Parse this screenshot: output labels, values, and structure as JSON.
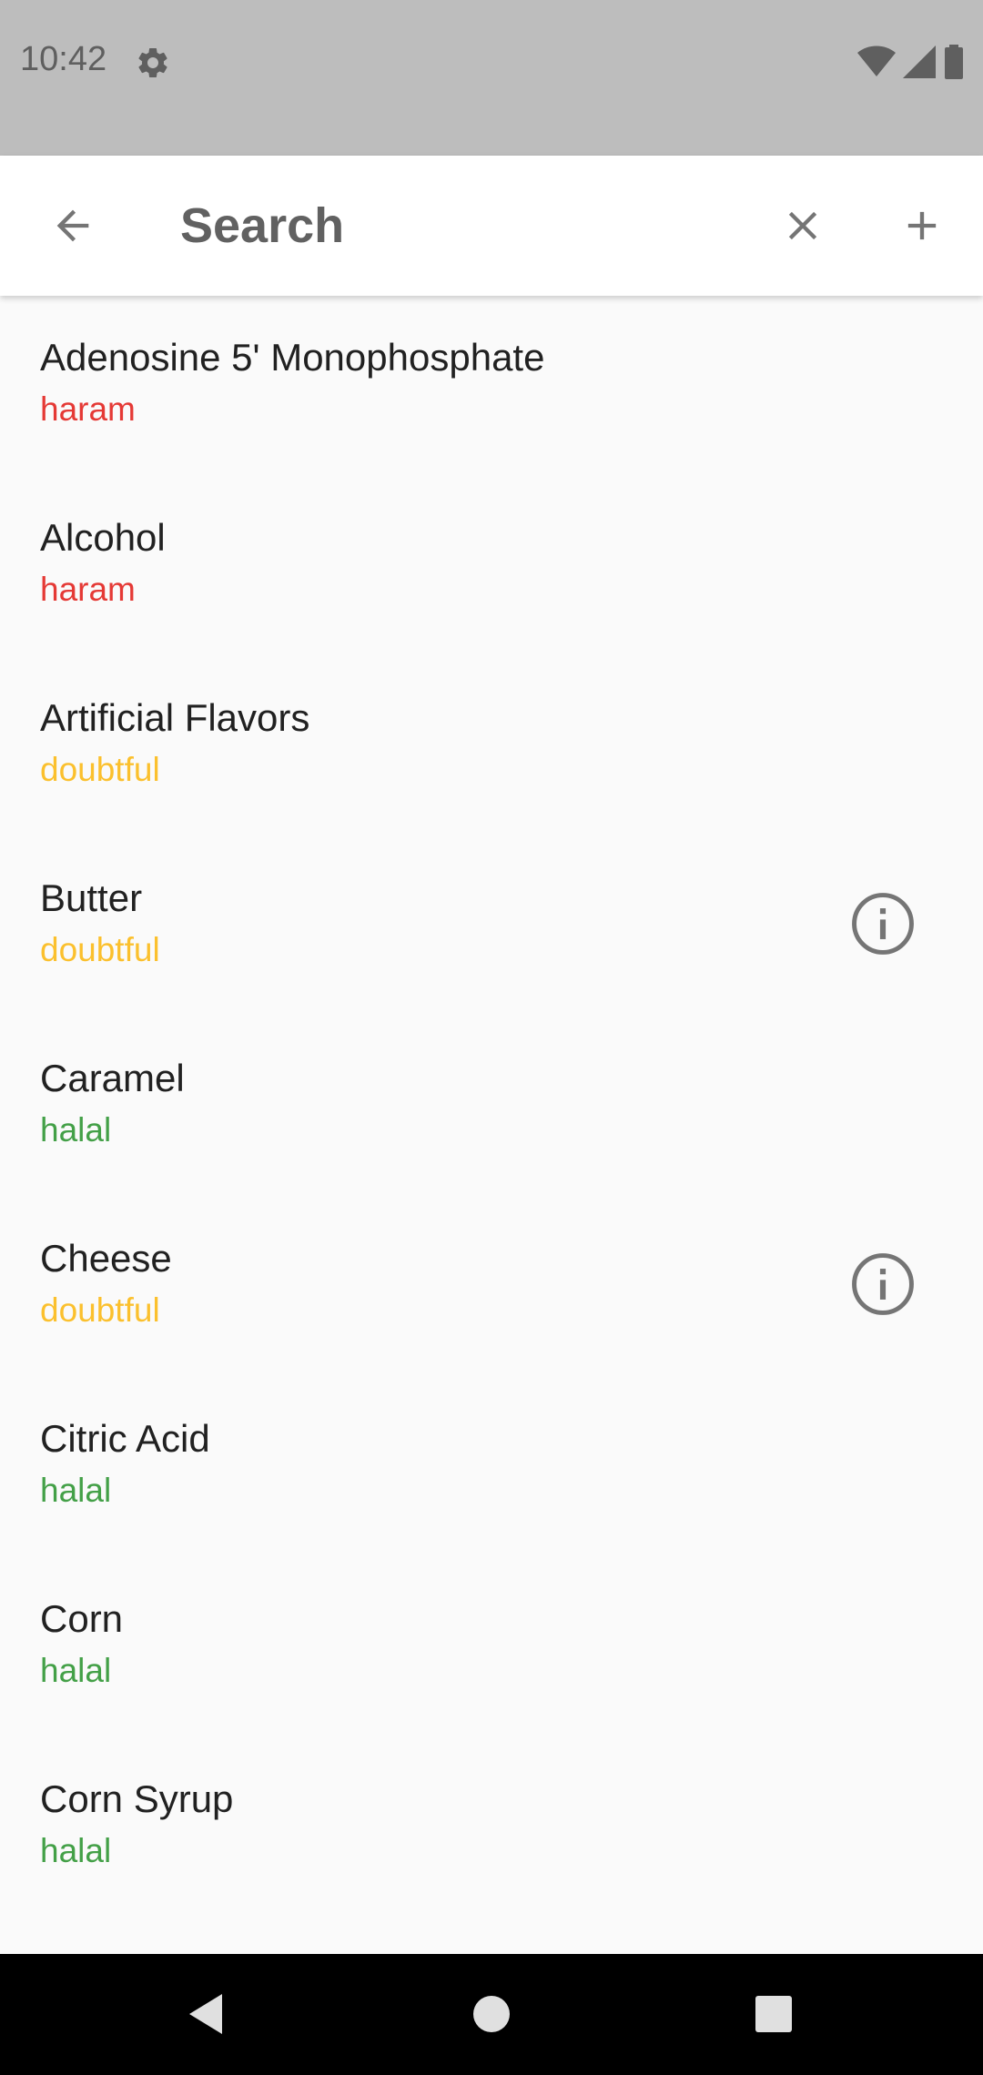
{
  "status_bar": {
    "time": "10:42",
    "icons": [
      "settings-icon",
      "wifi-icon",
      "signal-icon",
      "battery-icon"
    ]
  },
  "search": {
    "placeholder": "Search",
    "value": ""
  },
  "colors": {
    "haram": "#e53935",
    "doubtful": "#fbc02d",
    "halal": "#43a047"
  },
  "ingredients": [
    {
      "name": "Adenosine 5' Monophosphate",
      "status": "haram",
      "info": false
    },
    {
      "name": "Alcohol",
      "status": "haram",
      "info": false
    },
    {
      "name": "Artificial Flavors",
      "status": "doubtful",
      "info": false
    },
    {
      "name": "Butter",
      "status": "doubtful",
      "info": true
    },
    {
      "name": "Caramel",
      "status": "halal",
      "info": false
    },
    {
      "name": "Cheese",
      "status": "doubtful",
      "info": true
    },
    {
      "name": "Citric Acid",
      "status": "halal",
      "info": false
    },
    {
      "name": "Corn",
      "status": "halal",
      "info": false
    },
    {
      "name": "Corn Syrup",
      "status": "halal",
      "info": false
    }
  ]
}
